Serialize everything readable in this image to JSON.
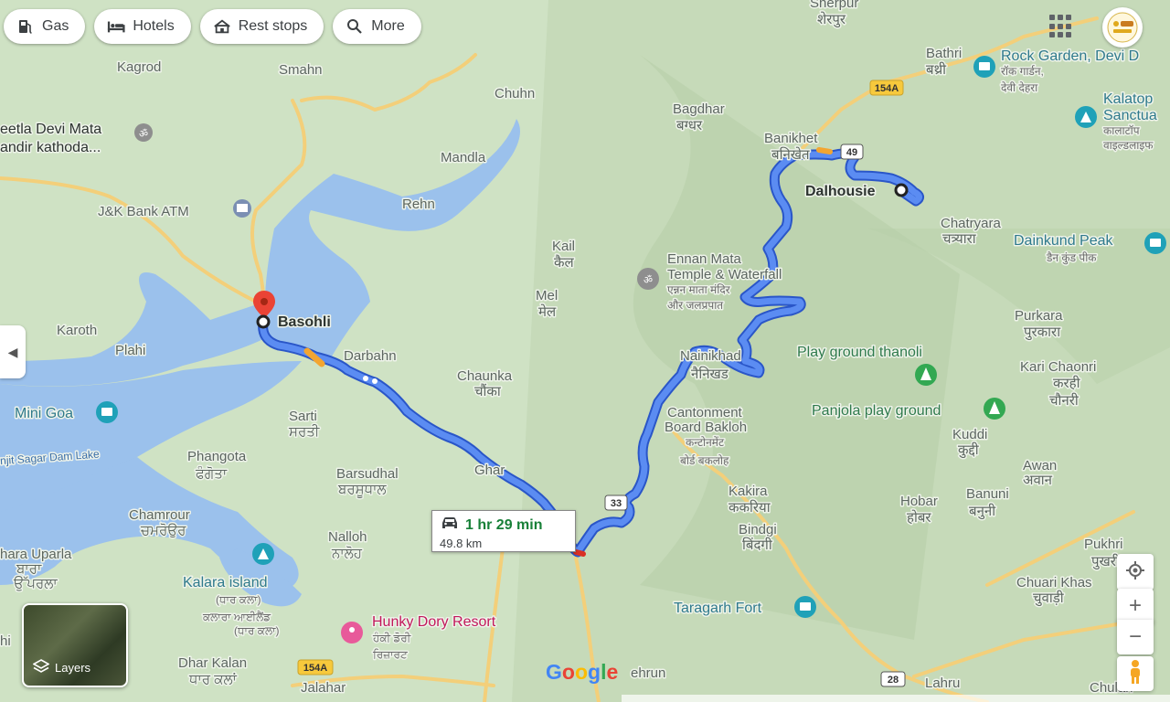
{
  "toolbar": {
    "gas": "Gas",
    "hotels": "Hotels",
    "rest_stops": "Rest stops",
    "more": "More"
  },
  "route": {
    "origin": "Basohli",
    "destination": "Dalhousie",
    "duration": "1 hr 29 min",
    "distance": "49.8 km"
  },
  "labels": {
    "kagrod": "Kagrod",
    "smahn": "Smahn",
    "chuhn": "Chuhn",
    "sherpur": "Sherpur",
    "sherpur_hi": "शेरपुर",
    "bathri": "Bathri",
    "bathri_hi": "बथ्री",
    "rock_garden": "Rock Garden, Devi D",
    "rock_garden_hi1": "रॉक गार्डन,",
    "rock_garden_hi2": "देवी देहरा",
    "kalatop1": "Kalatop",
    "kalatop2": "Sanctua",
    "kalatop_hi1": "कालाटॉप",
    "kalatop_hi2": "वाइल्डलाइफ",
    "seetla1": "eetla Devi Mata",
    "seetla2": "andir kathoda...",
    "bagdhar": "Bagdhar",
    "bagdhar_hi": "बग्धर",
    "banikhet": "Banikhet",
    "banikhet_hi": "बनिखेत",
    "mandla": "Mandla",
    "jk_bank": "J&K Bank ATM",
    "rehn": "Rehn",
    "chatryara": "Chatryara",
    "chatryara_hi": "चत्र्यारा",
    "dainkund": "Dainkund Peak",
    "dainkund_hi": "डैन कुंड पीक",
    "kail": "Kail",
    "kail_hi": "कैल",
    "ennan1": "Ennan Mata",
    "ennan2": "Temple & Waterfall",
    "ennan_hi1": "एन्नन माता मंदिर",
    "ennan_hi2": "और जलप्रपात",
    "mel": "Mel",
    "mel_hi": "मेल",
    "purkara": "Purkara",
    "purkara_hi": "पुरकारा",
    "karoth": "Karoth",
    "plahi": "Plahi",
    "darbahn": "Darbahn",
    "nainikhad": "Nainikhad",
    "nainikhad_hi": "नैनिखड",
    "play_ground": "Play ground thanoli",
    "kari_chaonri": "Kari Chaonri",
    "kari_hi1": "करही",
    "kari_hi2": "चौनरी",
    "chaunka": "Chaunka",
    "chaunka_hi": "चौंका",
    "mini_goa": "Mini Goa",
    "cantonment1": "Cantonment",
    "cantonment2": "Board Bakloh",
    "cantonment_hi1": "कन्टोनमेंट",
    "cantonment_hi2": "बोर्ड बकलोह",
    "panjola": "Panjola play ground",
    "kuddi": "Kuddi",
    "kuddi_hi": "कुद्दी",
    "sarti": "Sarti",
    "sarti_pa": "ਸਰਤੀ",
    "ranjit": "njit Sagar Dam Lake",
    "phangota": "Phangota",
    "phangota_pa": "ਫੰਗੋਤਾ",
    "awan": "Awan",
    "awan_hi": "अवान",
    "ghar": "Ghar",
    "barsudhal": "Barsudhal",
    "barsudhal_pa": "ਬਰਸੂਧਾਲ",
    "kakira": "Kakira",
    "kakira_hi": "ककरिया",
    "hobar": "Hobar",
    "hobar_hi": "होबर",
    "banuni": "Banuni",
    "banuni_hi": "बनुनी",
    "chamrour": "Chamrour",
    "chamrour_pa": "ਚਮਰੋਉਰ",
    "bindgi": "Bindgi",
    "bindgi_hi": "बिंदगी",
    "nalloh": "Nalloh",
    "nalloh_pa": "ਨਾਲੋਹ",
    "hara_uparla": "hara Uparla",
    "hara_pa1": "ਬਾਰਾ",
    "hara_pa2": "ਉੱਪਰਲਾ",
    "pukhri": "Pukhri",
    "pukhri_hi": "पुखरी",
    "kalara1": "Kalara island",
    "kalara_pa1": "(ਧਾਰ ਕਲਾ)",
    "kalara_pa2": "ਕਲਾਰਾ ਆਈਲੈਂਡ",
    "kalara_pa3": "(ਧਾਰ ਕਲਾ)",
    "taragarh": "Taragarh Fort",
    "chuari": "Chuari Khas",
    "chuari_hi": "चुवाड़ी",
    "hunky": "Hunky Dory Resort",
    "hunky_pa1": "ਹੰਕੀ ਡੋਰੀ",
    "hunky_pa2": "ਰਿਜ਼ਾਰਟ",
    "dhar_kalan": "Dhar Kalan",
    "dhar_pa": "ਧਾਰ ਕਲਾਂ",
    "jalahar": "Jalahar",
    "ehrun": "ehrun",
    "lahru": "Lahru",
    "chulari": "Chulari",
    "hi_left": "hi"
  },
  "shields": {
    "nh154a_top": "154A",
    "nh49": "49",
    "nh33": "33",
    "nh154a_bottom": "154A",
    "nh28": "28"
  },
  "controls": {
    "layers": "Layers",
    "zoom_in": "+",
    "zoom_out": "−",
    "google": "Google"
  },
  "colors": {
    "route": "#4a78e8",
    "route_outline": "#2a56c8",
    "water": "#90b9e8",
    "road": "#f6d58a",
    "traffic": "#f3a531",
    "pin": "#ea4335"
  }
}
